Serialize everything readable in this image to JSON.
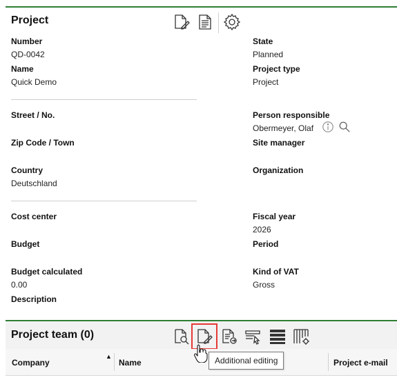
{
  "project": {
    "title": "Project",
    "fields": {
      "number": {
        "label": "Number",
        "value": "QD-0042"
      },
      "state": {
        "label": "State",
        "value": "Planned"
      },
      "name": {
        "label": "Name",
        "value": "Quick Demo"
      },
      "project_type": {
        "label": "Project type",
        "value": "Project"
      },
      "street": {
        "label": "Street / No.",
        "value": ""
      },
      "person_responsible": {
        "label": "Person responsible",
        "value": "Obermeyer, Olaf"
      },
      "zip_town": {
        "label": "Zip Code / Town",
        "value": ""
      },
      "site_manager": {
        "label": "Site manager",
        "value": ""
      },
      "country": {
        "label": "Country",
        "value": "Deutschland"
      },
      "organization": {
        "label": "Organization",
        "value": ""
      },
      "cost_center": {
        "label": "Cost center",
        "value": ""
      },
      "fiscal_year": {
        "label": "Fiscal year",
        "value": "2026"
      },
      "budget": {
        "label": "Budget",
        "value": ""
      },
      "period": {
        "label": "Period",
        "value": ""
      },
      "budget_calculated": {
        "label": "Budget calculated",
        "value": "0.00"
      },
      "kind_of_vat": {
        "label": "Kind of VAT",
        "value": "Gross"
      },
      "description": {
        "label": "Description",
        "value": ""
      }
    },
    "icons": [
      "edit-document-icon",
      "document-icon",
      "gear-icon"
    ]
  },
  "team": {
    "title": "Project team (0)",
    "columns": [
      "Company",
      "Name",
      "Project e-mail"
    ],
    "sort_column": "Company",
    "tooltip": "Additional editing"
  },
  "colors": {
    "accent": "#2e7d32",
    "highlight": "#e53935"
  }
}
